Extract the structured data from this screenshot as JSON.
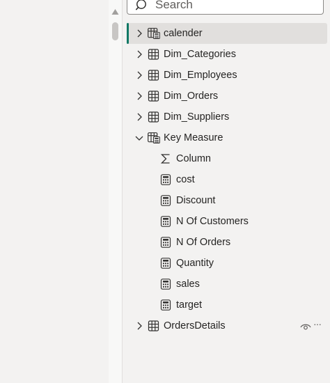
{
  "search": {
    "placeholder": "Search",
    "icon": "search-icon"
  },
  "tables": [
    {
      "label": "calender",
      "expanded": false,
      "selected": true,
      "icon": "calc-table-icon"
    },
    {
      "label": "Dim_Categories",
      "expanded": false,
      "icon": "table-icon"
    },
    {
      "label": "Dim_Employees",
      "expanded": false,
      "icon": "table-icon"
    },
    {
      "label": "Dim_Orders",
      "expanded": false,
      "icon": "table-icon"
    },
    {
      "label": "Dim_Suppliers",
      "expanded": false,
      "icon": "table-icon"
    },
    {
      "label": "Key Measure",
      "expanded": true,
      "icon": "calc-table-icon",
      "children": [
        {
          "label": "Column",
          "icon": "sigma-icon"
        },
        {
          "label": "cost",
          "icon": "calculator-icon"
        },
        {
          "label": "Discount",
          "icon": "calculator-icon"
        },
        {
          "label": "N Of Customers",
          "icon": "calculator-icon"
        },
        {
          "label": "N Of Orders",
          "icon": "calculator-icon"
        },
        {
          "label": "Quantity",
          "icon": "calculator-icon"
        },
        {
          "label": "sales",
          "icon": "calculator-icon"
        },
        {
          "label": "target",
          "icon": "calculator-icon"
        }
      ]
    },
    {
      "label": "OrdersDetails",
      "expanded": false,
      "icon": "table-icon",
      "more": "···"
    }
  ],
  "colors": {
    "selected_accent": "#117865",
    "selected_bg": "#e1dfdd",
    "background": "#f3f2f1"
  }
}
